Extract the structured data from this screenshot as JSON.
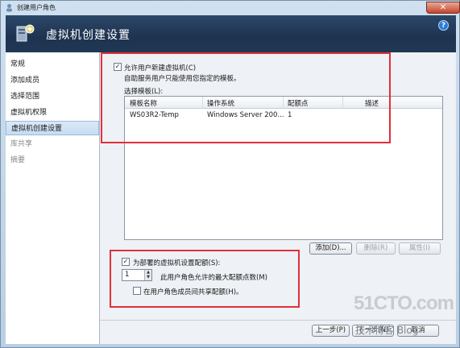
{
  "window": {
    "title": "创建用户角色",
    "close_label": "✕"
  },
  "header": {
    "title": "虚拟机创建设置",
    "help_label": "?"
  },
  "sidebar": {
    "items": [
      {
        "label": "常规"
      },
      {
        "label": "添加成员"
      },
      {
        "label": "选择范围"
      },
      {
        "label": "虚拟机权限"
      },
      {
        "label": "虚拟机创建设置"
      },
      {
        "label": "库共享"
      },
      {
        "label": "摘要"
      }
    ]
  },
  "create_vm": {
    "allow_label": "允许用户新建虚拟机(C)",
    "allow_checked": true,
    "description": "自助服务用户只能使用您指定的模板。",
    "select_template_label": "选择模板(L):"
  },
  "templates": {
    "columns": [
      "模板名称",
      "操作系统",
      "配额点",
      "描述"
    ],
    "rows": [
      {
        "name": "WS03R2-Temp",
        "os": "Windows Server 200...",
        "quota": "1",
        "desc": ""
      }
    ]
  },
  "template_buttons": {
    "add": "添加(D)...",
    "remove": "删除(R)",
    "properties": "属性(I)"
  },
  "quota": {
    "set_quota_label": "为部署的虚拟机设置配额(S):",
    "set_quota_checked": true,
    "max_points_value": "1",
    "max_points_label": "此用户角色允许的最大配额点数(M)",
    "share_label": "在用户角色成员间共享配额(H)。",
    "share_checked": false
  },
  "footer": {
    "prev": "上一步(P)",
    "next": "下一步(N)",
    "cancel": "取消"
  },
  "watermark": {
    "site": "51CTO.com",
    "blog": "技术博客 Blog"
  },
  "colors": {
    "highlight_box": "#e0303a",
    "header_bg": "#1e3350",
    "selected_nav": "#c7dcf2"
  }
}
